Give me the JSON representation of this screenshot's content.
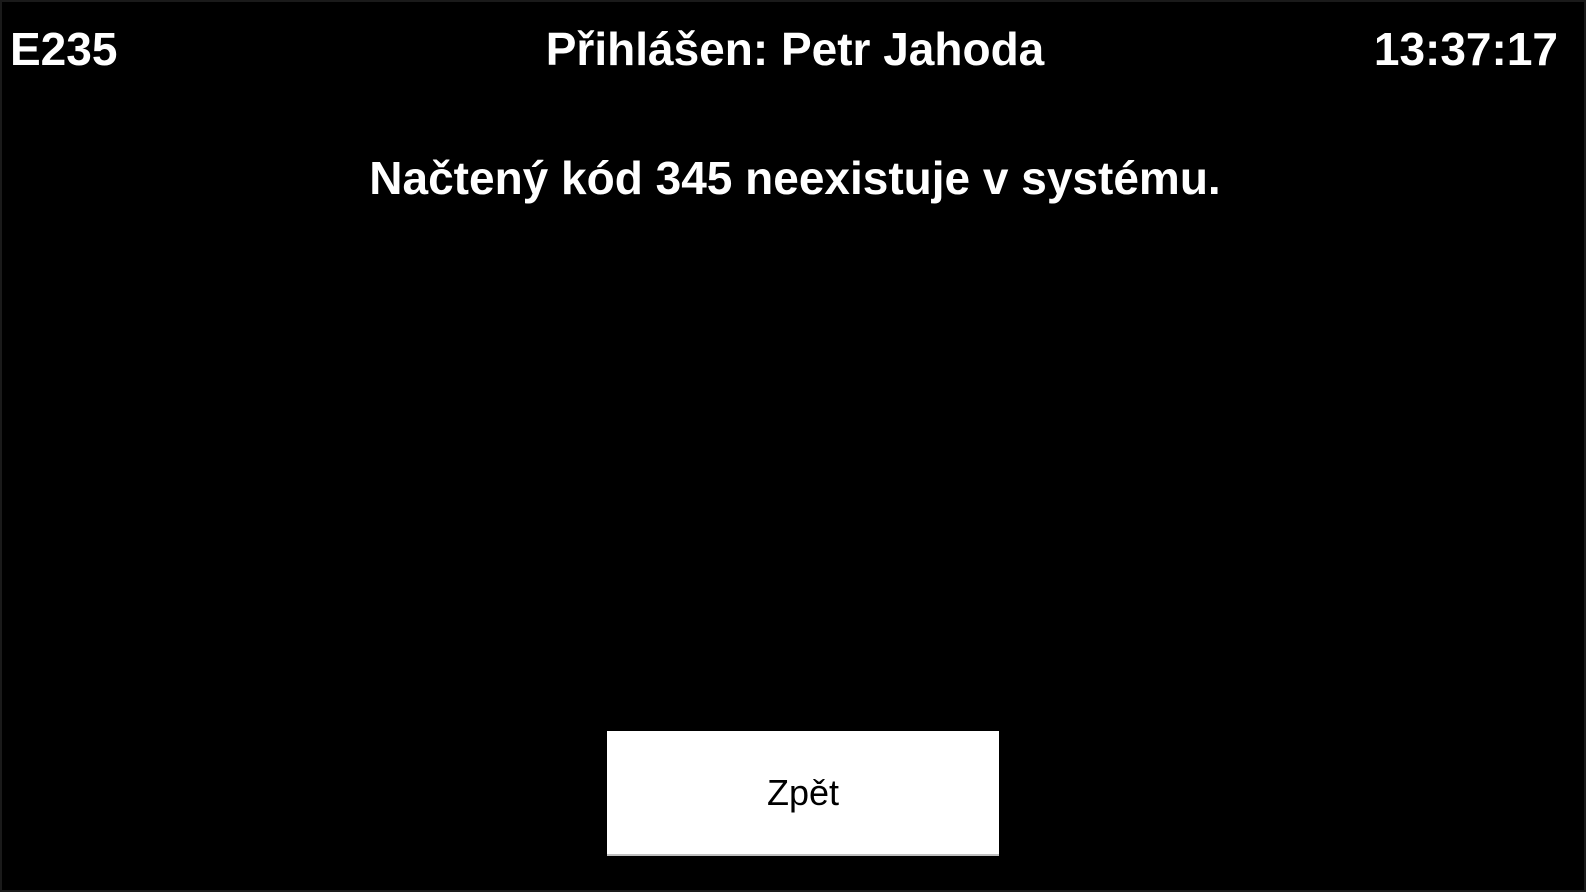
{
  "header": {
    "terminal_id": "E235",
    "logged_in_label": "Přihlášen: Petr Jahoda",
    "clock": "13:37:17"
  },
  "main": {
    "message": "Načtený kód 345 neexistuje v systému."
  },
  "actions": {
    "back_label": "Zpět"
  },
  "colors": {
    "background": "#000000",
    "text": "#ffffff",
    "button_background": "#ffffff",
    "button_text": "#000000"
  }
}
